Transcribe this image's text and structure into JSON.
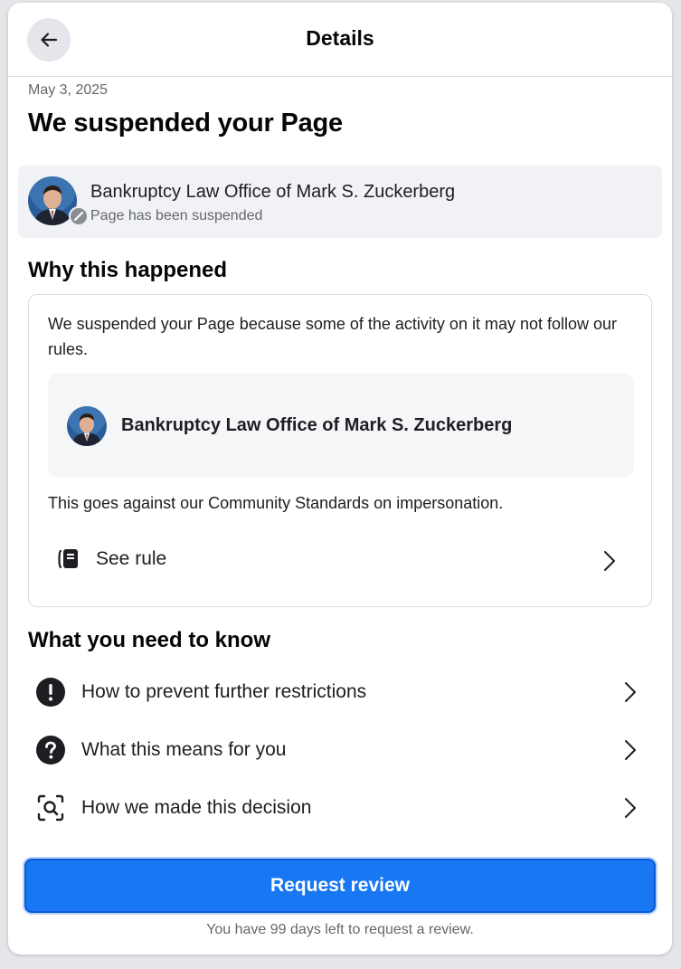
{
  "header": {
    "title": "Details",
    "back_icon": "arrow-left-icon"
  },
  "notice": {
    "date": "May 3, 2025",
    "title": "We suspended your Page"
  },
  "page": {
    "name": "Bankruptcy Law Office of Mark S. Zuckerberg",
    "status": "Page has been suspended"
  },
  "why": {
    "heading": "Why this happened",
    "explanation": "We suspended your Page because some of the activity on it may not follow our rules.",
    "page_name": "Bankruptcy Law Office of Mark S. Zuckerberg",
    "standards": "This goes against our Community Standards on impersonation.",
    "see_rule_label": "See rule"
  },
  "know": {
    "heading": "What you need to know",
    "items": [
      {
        "label": "How to prevent further restrictions",
        "icon": "exclamation-circle-icon"
      },
      {
        "label": "What this means for you",
        "icon": "question-circle-icon"
      },
      {
        "label": "How we made this decision",
        "icon": "magnify-scan-icon"
      }
    ]
  },
  "footer": {
    "request_label": "Request review",
    "days_left": "You have 99 days left to request a review."
  },
  "colors": {
    "accent": "#1877f2",
    "secondary_text": "#65676b",
    "strip_bg": "#f0f2f5"
  }
}
